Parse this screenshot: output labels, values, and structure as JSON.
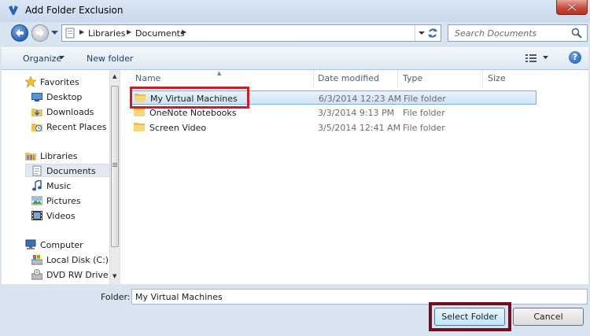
{
  "window": {
    "title": "Add Folder Exclusion",
    "title_icon": "app-logo-icon"
  },
  "address_bar": {
    "crumbs": [
      "Libraries",
      "Documents"
    ]
  },
  "search": {
    "placeholder": "Search Documents"
  },
  "command_bar": {
    "organize": "Organize",
    "new_folder": "New folder"
  },
  "nav": {
    "favorites": "Favorites",
    "desktop": "Desktop",
    "downloads": "Downloads",
    "recent_places": "Recent Places",
    "libraries": "Libraries",
    "documents": "Documents",
    "music": "Music",
    "pictures": "Pictures",
    "videos": "Videos",
    "computer": "Computer",
    "local_disk": "Local Disk (C:)",
    "dvd_drive": "DVD RW Drive (D"
  },
  "columns": {
    "name": "Name",
    "date_modified": "Date modified",
    "type": "Type",
    "size": "Size"
  },
  "files": [
    {
      "name": "My Virtual Machines",
      "date": "6/3/2014 12:23 AM",
      "type": "File folder"
    },
    {
      "name": "OneNote Notebooks",
      "date": "3/3/2014 9:13 PM",
      "type": "File folder"
    },
    {
      "name": "Screen Video",
      "date": "3/5/2014 12:41 AM",
      "type": "File folder"
    }
  ],
  "footer": {
    "folder_label": "Folder:",
    "folder_value": "My Virtual Machines",
    "select_button": "Select Folder",
    "cancel_button": "Cancel"
  },
  "colors": {
    "selection_border": "#84acdd",
    "highlight_red": "#d21a25",
    "highlight_dark": "#6e1020"
  }
}
